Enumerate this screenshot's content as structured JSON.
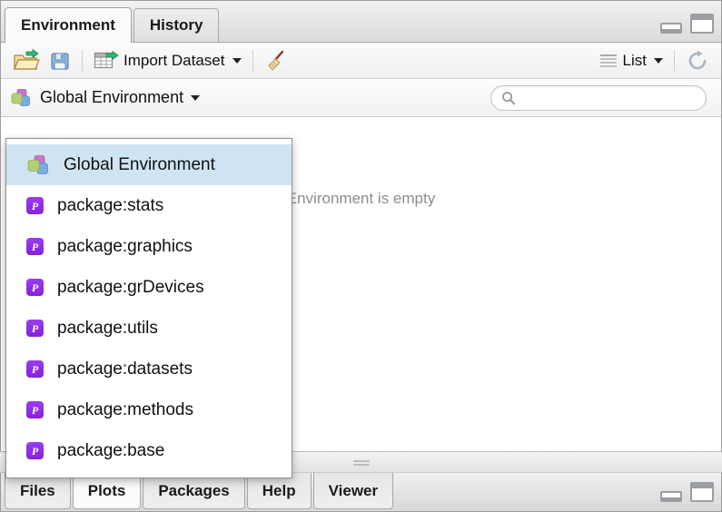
{
  "window": {
    "pane_minimize_label": "Minimize pane",
    "pane_maximize_label": "Maximize pane"
  },
  "top_tabs": [
    {
      "label": "Environment",
      "active": true
    },
    {
      "label": "History",
      "active": false
    }
  ],
  "toolbar": {
    "load_workspace_icon": "open-folder-icon",
    "save_workspace_icon": "floppy-disk-icon",
    "import_dataset_label": "Import Dataset",
    "import_dataset_icon": "grid-import-icon",
    "clear_icon": "broom-icon",
    "view_mode_label": "List",
    "view_mode_icon": "list-lines-icon",
    "refresh_icon": "refresh-icon"
  },
  "envbar": {
    "current_environment": "Global Environment",
    "environment_icon": "global-environment-icon",
    "search_placeholder": "",
    "search_value": "",
    "search_icon": "magnifier-icon"
  },
  "env_body": {
    "empty_message": "Environment is empty"
  },
  "dropdown": {
    "items": [
      {
        "label": "Global Environment",
        "icon": "global-environment-icon",
        "selected": true
      },
      {
        "label": "package:stats",
        "icon": "package-icon",
        "selected": false
      },
      {
        "label": "package:graphics",
        "icon": "package-icon",
        "selected": false
      },
      {
        "label": "package:grDevices",
        "icon": "package-icon",
        "selected": false
      },
      {
        "label": "package:utils",
        "icon": "package-icon",
        "selected": false
      },
      {
        "label": "package:datasets",
        "icon": "package-icon",
        "selected": false
      },
      {
        "label": "package:methods",
        "icon": "package-icon",
        "selected": false
      },
      {
        "label": "package:base",
        "icon": "package-icon",
        "selected": false
      }
    ]
  },
  "bottom_tabs": [
    {
      "label": "Files",
      "active": false
    },
    {
      "label": "Plots",
      "active": true
    },
    {
      "label": "Packages",
      "active": false
    },
    {
      "label": "Help",
      "active": false
    },
    {
      "label": "Viewer",
      "active": false
    }
  ],
  "colors": {
    "selection_blue": "#cfe4f3",
    "package_purple": "#8d2be2",
    "accent_green": "#3cb878",
    "empty_text_gray": "#8d8d8d"
  }
}
